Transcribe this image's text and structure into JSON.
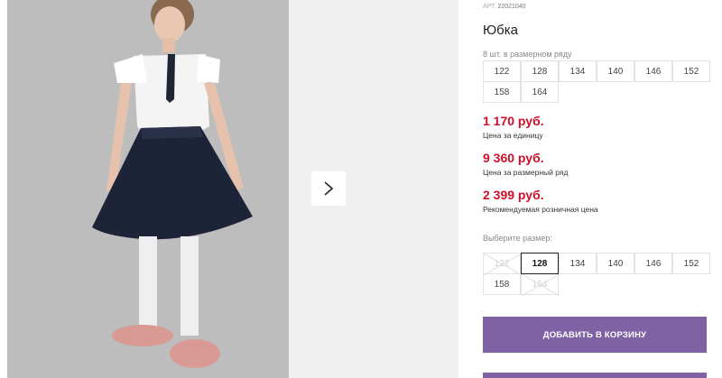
{
  "gallery": {
    "next_icon": "chevron-right-icon"
  },
  "product": {
    "art_label": "АРТ.",
    "art_number": "22021040",
    "title": "Юбка",
    "pack_caption": "8 шт. в размерном ряду",
    "pack_sizes": [
      "122",
      "128",
      "134",
      "140",
      "146",
      "152",
      "158",
      "164"
    ],
    "prices": [
      {
        "value": "1 170 руб.",
        "note": "Цена за единицу"
      },
      {
        "value": "9 360 руб.",
        "note": "Цена за размерный ряд"
      },
      {
        "value": "2 399 руб.",
        "note": "Рекомендуемая розничная цена"
      }
    ],
    "select_caption": "Выберите размер:",
    "select_sizes": [
      {
        "label": "122",
        "state": "unavailable"
      },
      {
        "label": "128",
        "state": "selected"
      },
      {
        "label": "134",
        "state": "available"
      },
      {
        "label": "140",
        "state": "available"
      },
      {
        "label": "146",
        "state": "available"
      },
      {
        "label": "152",
        "state": "available"
      },
      {
        "label": "158",
        "state": "available"
      },
      {
        "label": "164",
        "state": "unavailable"
      }
    ],
    "cart_button": "ДОБАВИТЬ В КОРЗИНУ"
  },
  "colors": {
    "price": "#d0102a",
    "button": "#7f62a4",
    "photo_bg": "#bfbfbf"
  }
}
